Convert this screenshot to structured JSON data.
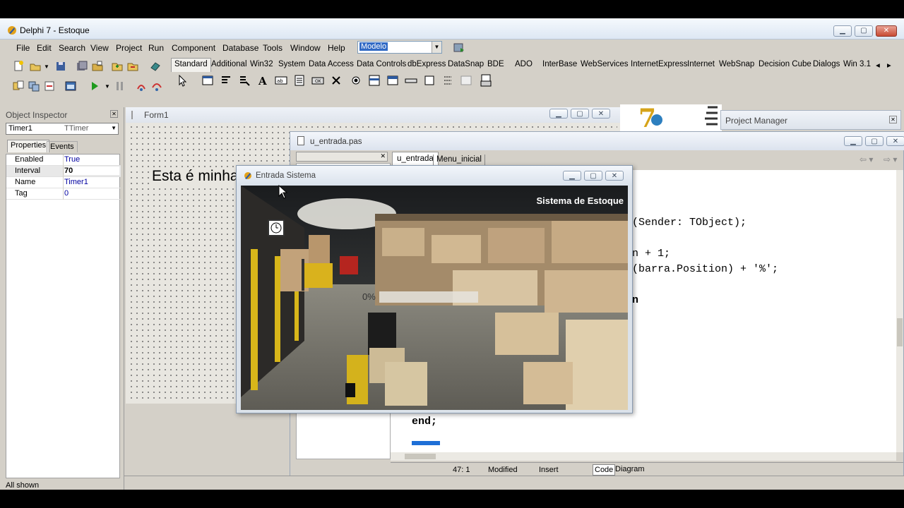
{
  "window": {
    "title": "Delphi 7 - Estoque",
    "controls": {
      "minimize": "▁",
      "maximize": "▢",
      "close": "✕"
    }
  },
  "menu": {
    "items": [
      "File",
      "Edit",
      "Search",
      "View",
      "Project",
      "Run",
      "Component",
      "Database",
      "Tools",
      "Window",
      "Help"
    ]
  },
  "desktop_combo": {
    "value": "Modelo"
  },
  "palette": {
    "tabs": [
      "Standard",
      "Additional",
      "Win32",
      "System",
      "Data Access",
      "Data Controls",
      "dbExpress",
      "DataSnap",
      "BDE",
      "ADO",
      "InterBase",
      "WebServices",
      "InternetExpress",
      "Internet",
      "WebSnap",
      "Decision Cube",
      "Dialogs",
      "Win 3.1"
    ]
  },
  "object_inspector": {
    "title": "Object Inspector",
    "selected_object": "Timer1",
    "selected_type": "TTimer",
    "tabs": [
      "Properties",
      "Events"
    ],
    "rows": [
      {
        "name": "Enabled",
        "value": "True"
      },
      {
        "name": "Interval",
        "value": "70"
      },
      {
        "name": "Name",
        "value": "Timer1"
      },
      {
        "name": "Tag",
        "value": "0"
      }
    ],
    "status": "All shown"
  },
  "form1": {
    "title": "Form1",
    "label": "Esta é minha janela"
  },
  "project_manager": {
    "title": "Project Manager"
  },
  "editor": {
    "title": "u_entrada.pas",
    "tabs": [
      "u_entrada",
      "Menu_inicial"
    ],
    "code_lines": [
      "(Sender: TObject);",
      "n + 1;",
      "(barra.Position) + '%';",
      "n"
    ],
    "code_end": "end;",
    "status": {
      "position": "47:  1",
      "modified": "Modified",
      "mode": "Insert",
      "view_tabs": [
        "Code",
        "Diagram"
      ]
    }
  },
  "dialog": {
    "title": "Entrada Sistema",
    "banner": "Sistema de Estoque",
    "progress_label": "0%",
    "progress_fraction": 0.0
  }
}
